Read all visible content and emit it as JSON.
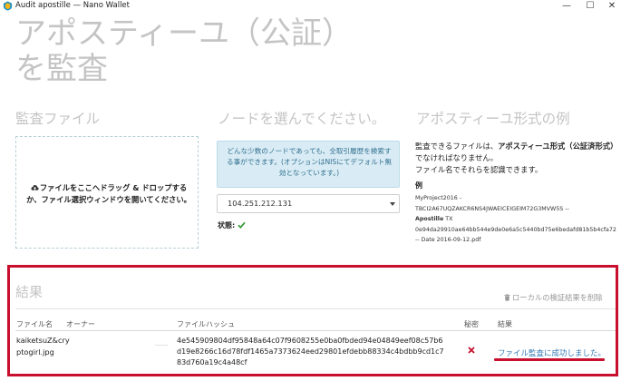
{
  "window": {
    "title": "Audit apostille — Nano Wallet",
    "minimize": "—",
    "maximize": "☐",
    "close": "✕"
  },
  "page": {
    "title_line1": "アポスティーユ（公証）",
    "title_line2": "を監査"
  },
  "audit_file": {
    "heading": "監査ファイル",
    "drop_text": "ファイルをここへドラッグ & ドロップするか、ファイル選択ウィンドウを開いてください。",
    "icon": "cloud-upload-icon"
  },
  "node": {
    "heading": "ノードを選んでください。",
    "info": "どんな少数のノードであっても、全取引履歴を検索する事ができます。(オプションはNISにてデフォルト無効となっています。)",
    "selected": "104.251.212.131",
    "status_label": "状態:",
    "status_icon": "check-icon",
    "status_color": "#3c9a3c"
  },
  "example": {
    "heading": "アポスティーユ形式の例",
    "desc_prefix": "監査できるファイルは、",
    "desc_bold": "アポスティーユ形式（公証済形式）",
    "desc_suffix": "でなければなりません。",
    "desc_line2": "ファイル名でそれらを認識できます。",
    "label": "例",
    "line1": "MyProject2016 -",
    "line2": "TBCI2A67UQZAKCR6NS4JWAEICEIGEIM72G3MVW5S --",
    "line3": "Apostille",
    "line3_suffix": " TX",
    "line4": "0e94da29910ae64bb544e9de0e6a5c5440bd75e6bedafd81b5b4cfa72",
    "line5": "-- Date 2016-09-12.pdf"
  },
  "results": {
    "heading": "結果",
    "clear_label": "ローカルの検証結果を削除",
    "columns": [
      "ファイル名",
      "オーナー",
      "ファイルハッシュ",
      "秘密",
      "結果"
    ],
    "rows": [
      {
        "filename": "kaiketsuZ&cryptogirl.jpg",
        "hash": "4e545909804df95848a64c07f9608255e0ba0fbded94e04849eef08c57b6d19e8266c16d78fdf1465a7373624eed29801efdebb88334c4bdbb9cd1c783d760a19c4a48cf",
        "secret_icon": "cross-icon",
        "result": "ファイル監査に成功しました。"
      }
    ],
    "accent": "#c8102e",
    "link_color": "#337ab7"
  }
}
